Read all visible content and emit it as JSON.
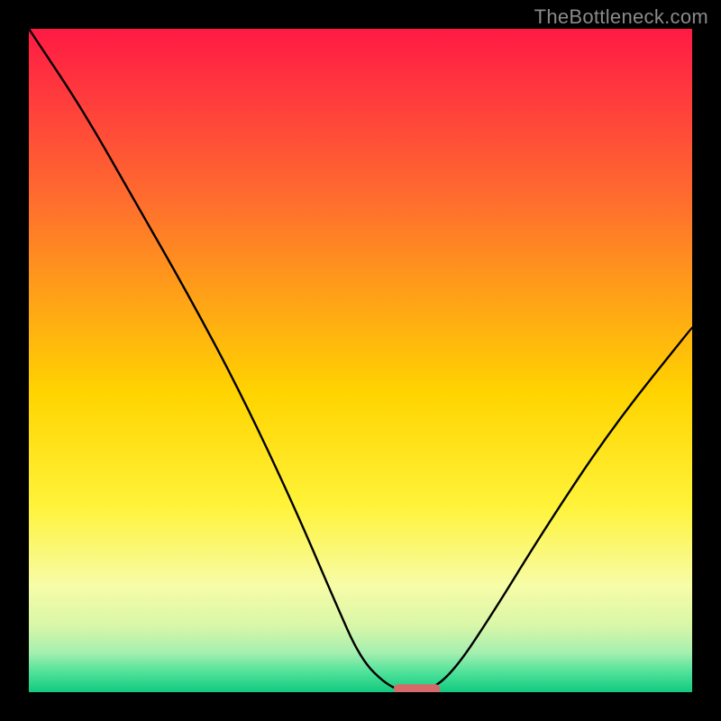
{
  "watermark": "TheBottleneck.com",
  "chart_data": {
    "type": "line",
    "title": "",
    "xlabel": "",
    "ylabel": "",
    "xlim": [
      0,
      100
    ],
    "ylim": [
      0,
      100
    ],
    "grid": false,
    "legend": false,
    "series": [
      {
        "name": "bottleneck-curve",
        "x": [
          0,
          8,
          16,
          24,
          32,
          40,
          46,
          50,
          54,
          57,
          60,
          64,
          70,
          78,
          88,
          100
        ],
        "values": [
          100,
          88,
          74,
          60,
          45,
          28,
          14,
          5,
          1,
          0,
          0,
          3,
          12,
          25,
          40,
          55
        ]
      }
    ],
    "optimal_marker": {
      "x_start": 55,
      "x_end": 62,
      "y": 0.5
    },
    "background": {
      "gradient_stops": [
        {
          "pct": 0,
          "color": "#ff1a44"
        },
        {
          "pct": 10,
          "color": "#ff3a3d"
        },
        {
          "pct": 25,
          "color": "#ff6a2f"
        },
        {
          "pct": 40,
          "color": "#ffa018"
        },
        {
          "pct": 55,
          "color": "#ffd400"
        },
        {
          "pct": 72,
          "color": "#fff33a"
        },
        {
          "pct": 84,
          "color": "#f7fca8"
        },
        {
          "pct": 90,
          "color": "#d8f7a8"
        },
        {
          "pct": 94,
          "color": "#a6efb0"
        },
        {
          "pct": 97,
          "color": "#4fe29a"
        },
        {
          "pct": 100,
          "color": "#12c97f"
        }
      ]
    }
  }
}
